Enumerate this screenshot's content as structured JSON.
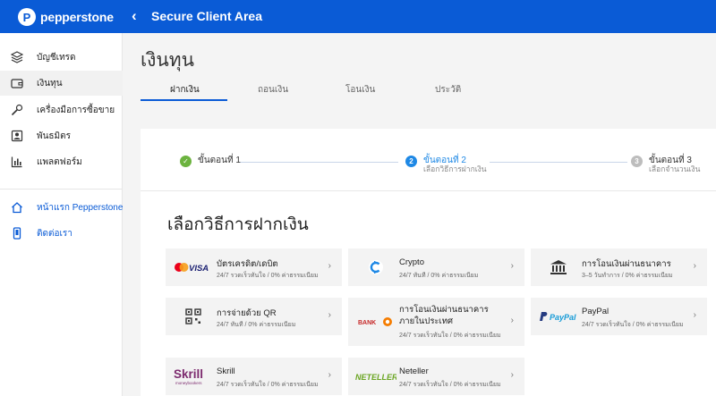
{
  "topbar": {
    "brand": "pepperstone",
    "title": "Secure Client Area"
  },
  "sidebar": {
    "items": [
      {
        "label": "บัญชีเทรด",
        "icon": "layers-icon"
      },
      {
        "label": "เงินทุน",
        "icon": "wallet-icon"
      },
      {
        "label": "เครื่องมือการซื้อขาย",
        "icon": "wrench-icon"
      },
      {
        "label": "พันธมิตร",
        "icon": "partner-icon"
      },
      {
        "label": "แพลตฟอร์ม",
        "icon": "bar-chart-icon"
      }
    ],
    "links": [
      {
        "label": "หน้าแรก Pepperstone",
        "icon": "home-icon"
      },
      {
        "label": "ติดต่อเรา",
        "icon": "phone-icon"
      }
    ]
  },
  "page": {
    "title": "เงินทุน",
    "tabs": [
      "ฝากเงิน",
      "ถอนเงิน",
      "โอนเงิน",
      "ประวัติ"
    ]
  },
  "stepper": {
    "steps": [
      {
        "number": "1",
        "title": "ขั้นตอนที่ 1",
        "subtitle": "",
        "state": "done"
      },
      {
        "number": "2",
        "title": "ขั้นตอนที่ 2",
        "subtitle": "เลือกวิธีการฝากเงิน",
        "state": "active"
      },
      {
        "number": "3",
        "title": "ขั้นตอนที่ 3",
        "subtitle": "เลือกจำนวนเงิน",
        "state": "pending"
      }
    ],
    "colors": {
      "done": "#6cb33f",
      "active": "#1e88e5",
      "pending": "#bdbdbd"
    }
  },
  "deposit": {
    "section_title": "เลือกวิธีการฝากเงิน",
    "methods": [
      {
        "title": "บัตรเครดิต/เดบิต",
        "subtitle": "24/7 รวดเร็วทันใจ / 0% ค่าธรรมเนียม",
        "logo": "visa-mastercard-logo",
        "brand_text": "VISA"
      },
      {
        "title": "Crypto",
        "subtitle": "24/7 ทันที / 0% ค่าธรรมเนียม",
        "logo": "crypto-logo"
      },
      {
        "title": "การโอนเงินผ่านธนาคาร",
        "subtitle": "3–5 วันทำการ / 0% ค่าธรรมเนียม",
        "logo": "bank-icon"
      },
      {
        "title": "การจ่ายด้วย QR",
        "subtitle": "24/7 ทันที / 0% ค่าธรรมเนียม",
        "logo": "qr-code-icon"
      },
      {
        "title": "การโอนเงินผ่านธนาคารภายในประเทศ",
        "subtitle": "24/7 รวดเร็วทันใจ / 0% ค่าธรรมเนียม",
        "logo": "local-bank-logo",
        "brand_text": "BANK"
      },
      {
        "title": "PayPal",
        "subtitle": "24/7 รวดเร็วทันใจ / 0% ค่าธรรมเนียม",
        "logo": "paypal-logo",
        "brand_text": "PayPal"
      },
      {
        "title": "Skrill",
        "subtitle": "24/7 รวดเร็วทันใจ / 0% ค่าธรรมเนียม",
        "logo": "skrill-logo",
        "brand_text": "Skrill",
        "brand_sub": "moneybookers"
      },
      {
        "title": "Neteller",
        "subtitle": "24/7 รวดเร็วทันใจ / 0% ค่าธรรมเนียม",
        "logo": "neteller-logo",
        "brand_text": "NETELLER"
      }
    ]
  },
  "colors": {
    "brand_blue": "#0a5bd6",
    "link_blue": "#0a5bd6",
    "tile_bg": "#f3f3f3"
  }
}
